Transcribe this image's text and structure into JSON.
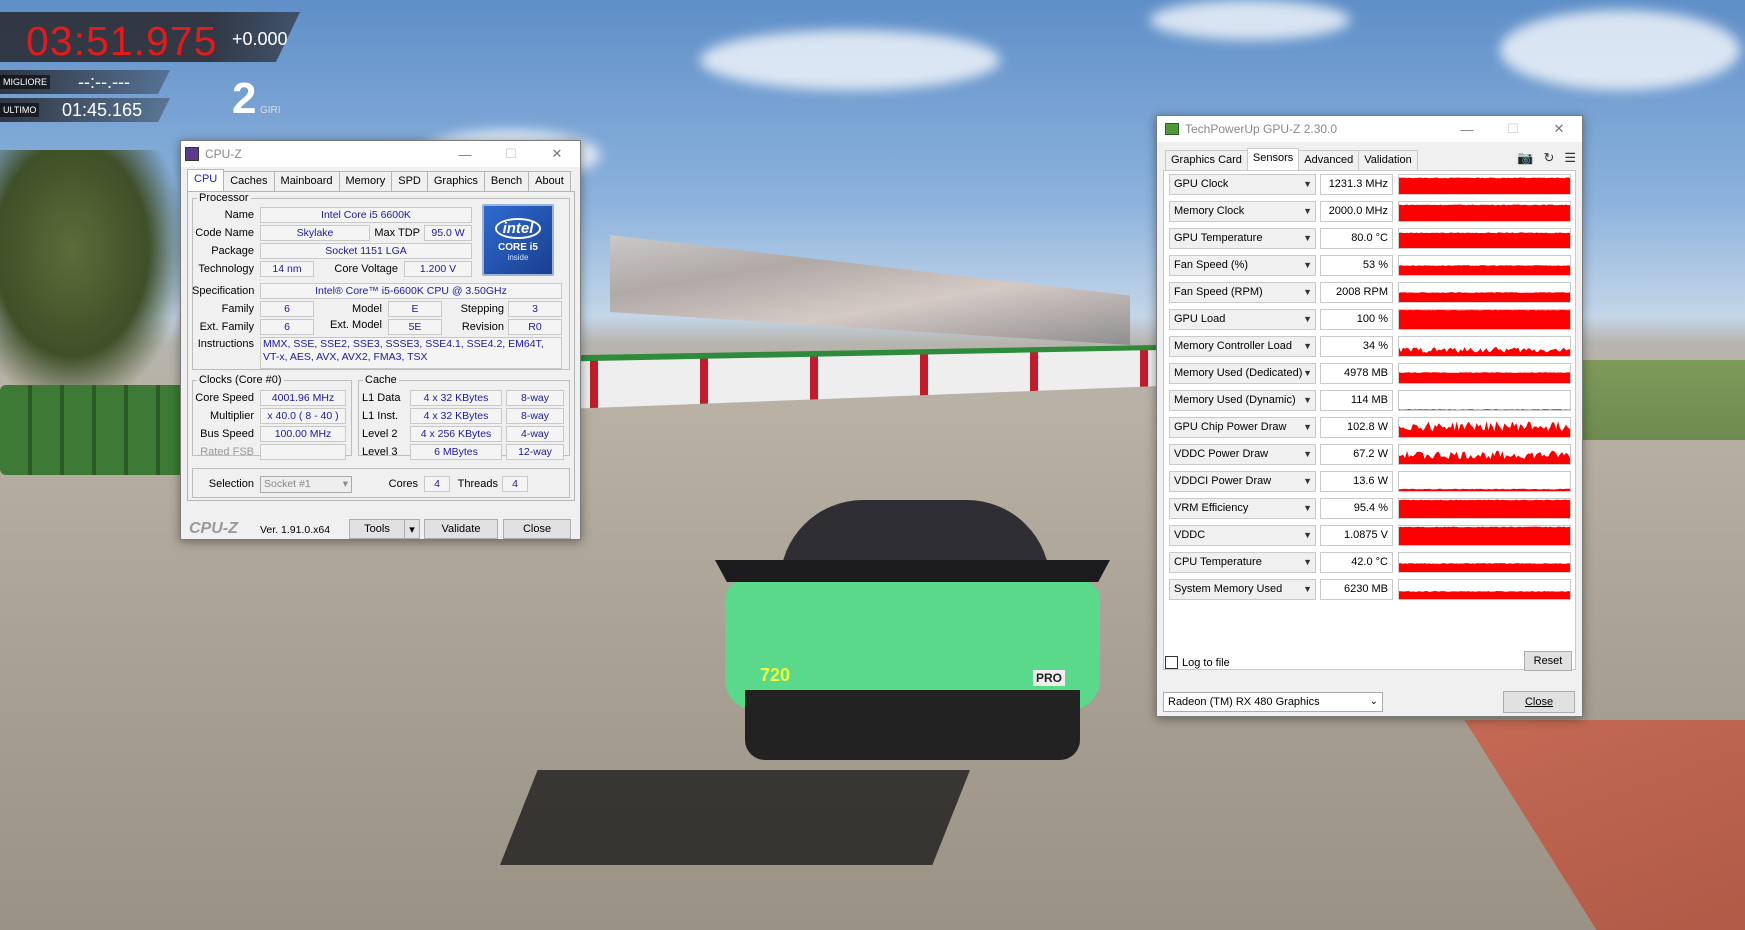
{
  "hud": {
    "current_time": "03:51.975",
    "delta": "+0.000",
    "best_label": "MIGLIORE",
    "best_value": "--:--.---",
    "last_label": "ULTIMO",
    "last_value": "01:45.165",
    "laps_value": "2",
    "laps_label": "GIRI"
  },
  "car": {
    "number": "720",
    "badge": "PRO"
  },
  "cpuz": {
    "title": "CPU-Z",
    "tabs": [
      "CPU",
      "Caches",
      "Mainboard",
      "Memory",
      "SPD",
      "Graphics",
      "Bench",
      "About"
    ],
    "processor": {
      "legend": "Processor",
      "name_label": "Name",
      "name": "Intel Core i5 6600K",
      "codename_label": "Code Name",
      "codename": "Skylake",
      "maxtdp_label": "Max TDP",
      "maxtdp": "95.0 W",
      "package_label": "Package",
      "package": "Socket 1151 LGA",
      "technology_label": "Technology",
      "technology": "14 nm",
      "corevoltage_label": "Core Voltage",
      "corevoltage": "1.200 V",
      "spec_label": "Specification",
      "spec": "Intel® Core™ i5-6600K CPU @ 3.50GHz",
      "family_label": "Family",
      "family": "6",
      "model_label": "Model",
      "model": "E",
      "stepping_label": "Stepping",
      "stepping": "3",
      "extfamily_label": "Ext. Family",
      "extfamily": "6",
      "extmodel_label": "Ext. Model",
      "extmodel": "5E",
      "revision_label": "Revision",
      "revision": "R0",
      "instructions_label": "Instructions",
      "instructions": "MMX, SSE, SSE2, SSE3, SSSE3, SSE4.1, SSE4.2, EM64T, VT-x, AES, AVX, AVX2, FMA3, TSX",
      "logo": {
        "brand": "intel",
        "line": "CORE i5",
        "sub": "inside"
      }
    },
    "clocks": {
      "legend": "Clocks (Core #0)",
      "corespeed_label": "Core Speed",
      "corespeed": "4001.96 MHz",
      "multiplier_label": "Multiplier",
      "multiplier": "x 40.0 ( 8 - 40 )",
      "busspeed_label": "Bus Speed",
      "busspeed": "100.00 MHz",
      "ratedfsb_label": "Rated FSB",
      "ratedfsb": ""
    },
    "cache": {
      "legend": "Cache",
      "rows": [
        {
          "label": "L1 Data",
          "size": "4 x 32 KBytes",
          "way": "8-way"
        },
        {
          "label": "L1 Inst.",
          "size": "4 x 32 KBytes",
          "way": "8-way"
        },
        {
          "label": "Level 2",
          "size": "4 x 256 KBytes",
          "way": "4-way"
        },
        {
          "label": "Level 3",
          "size": "6 MBytes",
          "way": "12-way"
        }
      ]
    },
    "selection_label": "Selection",
    "selection": "Socket #1",
    "cores_label": "Cores",
    "cores": "4",
    "threads_label": "Threads",
    "threads": "4",
    "brand": "CPU-Z",
    "version": "Ver. 1.91.0.x64",
    "tools_button": "Tools",
    "validate_button": "Validate",
    "close_button": "Close"
  },
  "gpuz": {
    "title": "TechPowerUp GPU-Z 2.30.0",
    "tabs": [
      "Graphics Card",
      "Sensors",
      "Advanced",
      "Validation"
    ],
    "active_tab": "Sensors",
    "sensors": [
      {
        "name": "GPU Clock",
        "value": "1231.3 MHz",
        "level": 0.85,
        "style": "solid"
      },
      {
        "name": "Memory Clock",
        "value": "2000.0 MHz",
        "level": 0.85,
        "style": "solid"
      },
      {
        "name": "GPU Temperature",
        "value": "80.0 °C",
        "level": 0.8,
        "style": "solid"
      },
      {
        "name": "Fan Speed (%)",
        "value": "53 %",
        "level": 0.5,
        "style": "solid"
      },
      {
        "name": "Fan Speed (RPM)",
        "value": "2008 RPM",
        "level": 0.5,
        "style": "solid"
      },
      {
        "name": "GPU Load",
        "value": "100 %",
        "level": 1.0,
        "style": "solid"
      },
      {
        "name": "Memory Controller Load",
        "value": "34 %",
        "level": 0.34,
        "style": "noisy"
      },
      {
        "name": "Memory Used (Dedicated)",
        "value": "4978 MB",
        "level": 0.55,
        "style": "solid"
      },
      {
        "name": "Memory Used (Dynamic)",
        "value": "114 MB",
        "level": 0.03,
        "style": "solid"
      },
      {
        "name": "GPU Chip Power Draw",
        "value": "102.8 W",
        "level": 0.6,
        "style": "noisy"
      },
      {
        "name": "VDDC Power Draw",
        "value": "67.2 W",
        "level": 0.5,
        "style": "noisy"
      },
      {
        "name": "VDDCI Power Draw",
        "value": "13.6 W",
        "level": 0.1,
        "style": "solid"
      },
      {
        "name": "VRM Efficiency",
        "value": "95.4 %",
        "level": 0.95,
        "style": "solid"
      },
      {
        "name": "VDDC",
        "value": "1.0875 V",
        "level": 0.95,
        "style": "solid"
      },
      {
        "name": "CPU Temperature",
        "value": "42.0 °C",
        "level": 0.45,
        "style": "solid"
      },
      {
        "name": "System Memory Used",
        "value": "6230 MB",
        "level": 0.4,
        "style": "solid"
      }
    ],
    "log_label": "Log to file",
    "reset_button": "Reset",
    "device": "Radeon (TM) RX 480 Graphics",
    "close_button": "Close",
    "graph_color": "#ff0000"
  }
}
